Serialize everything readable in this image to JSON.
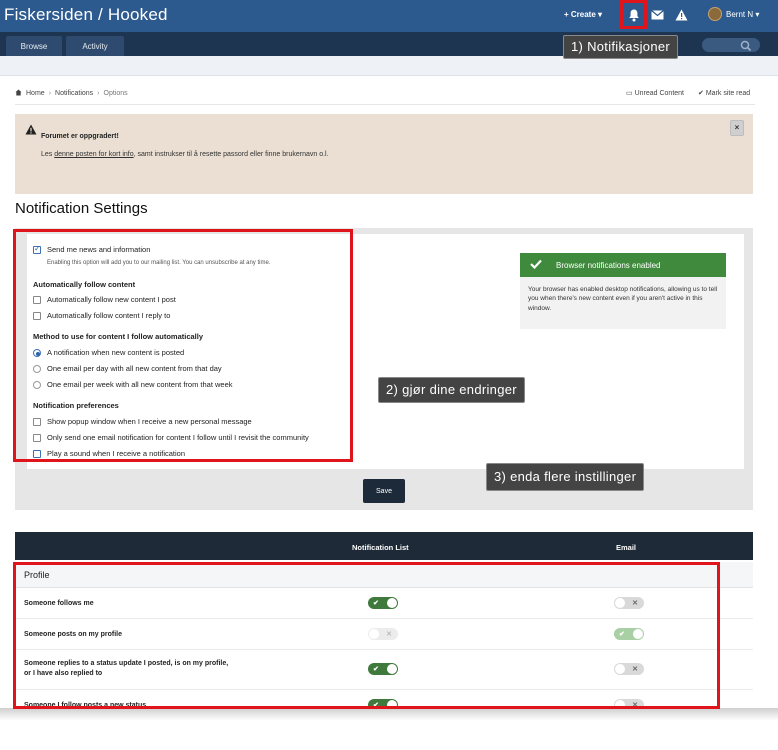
{
  "header": {
    "site_title": "Fiskersiden / Hooked",
    "create_label": "+ Create ▾",
    "user_name": "Bernt N ▾"
  },
  "nav": {
    "tabs": [
      {
        "label": "Browse"
      },
      {
        "label": "Activity"
      }
    ]
  },
  "breadcrumb": {
    "home": "Home",
    "sep": "›",
    "notifications": "Notifications",
    "options": "Options",
    "unread_content": "Unread Content",
    "mark_site_read": "Mark site read"
  },
  "announcement": {
    "title": "Forumet er oppgradert!",
    "text_prefix": "Les ",
    "link_text": "denne posten for kort info",
    "text_suffix": ", samt instrukser til å resette passord eller finne brukernavn o.l.",
    "close": "×"
  },
  "settings": {
    "title": "Notification Settings",
    "newsletter_label": "Send me news and information",
    "newsletter_desc": "Enabling this option will add you to our mailing list. You can unsubscribe at any time.",
    "auto_follow_head": "Automatically follow content",
    "auto_follow_new": "Automatically follow new content I post",
    "auto_follow_reply": "Automatically follow content I reply to",
    "method_head": "Method to use for content I follow automatically",
    "method_notification": "A notification when new content is posted",
    "method_daily": "One email per day with all new content from that day",
    "method_weekly": "One email per week with all new content from that week",
    "prefs_head": "Notification preferences",
    "pref_popup": "Show popup window when I receive a new personal message",
    "pref_one_email": "Only send one email notification for content I follow until I revisit the community",
    "pref_sound": "Play a sound when I receive a notification",
    "browser_banner": "Browser notifications enabled",
    "browser_desc": "Your browser has enabled desktop notifications, allowing us to tell you when there's new content even if you aren't active in this window.",
    "save_label": "Save"
  },
  "table": {
    "col_notification_list": "Notification List",
    "col_email": "Email",
    "profile_label": "Profile",
    "rows": [
      {
        "label": "Someone follows me",
        "notif": "on",
        "email": "off"
      },
      {
        "label": "Someone posts on my profile",
        "notif": "off-light",
        "email": "on-light"
      },
      {
        "label": "Someone replies to a status update I posted, is on my profile,",
        "label2": "or I have also replied to",
        "notif": "on",
        "email": "off"
      },
      {
        "label": "Someone I follow posts a new status",
        "notif": "on",
        "email": "off"
      }
    ]
  },
  "callouts": {
    "c1": "1) Notifikasjoner",
    "c2": "2) gjør dine endringer",
    "c3": "3) enda flere instillinger"
  },
  "colors": {
    "header_blue": "#2d5a8e",
    "nav_dark": "#1e3552",
    "toggle_green": "#3f7a3c",
    "highlight_red": "#e0151b",
    "announcement_bg": "#eadfd2"
  }
}
